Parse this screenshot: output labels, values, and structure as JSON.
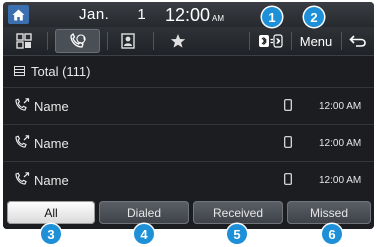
{
  "status_bar": {
    "date_month": "Jan.",
    "date_day": "1",
    "time": "12:00",
    "ampm": "AM"
  },
  "tabs": {
    "icons": [
      "dialpad-icon",
      "call-history-icon",
      "contacts-icon",
      "favorites-icon",
      "bluetooth-device-icon"
    ],
    "active": "call-history-icon",
    "menu_label": "Menu",
    "back_icon": "back-icon"
  },
  "list": {
    "header": "Total (111)",
    "rows": [
      {
        "name": "Name",
        "time": "12:00 AM"
      },
      {
        "name": "Name",
        "time": "12:00 AM"
      },
      {
        "name": "Name",
        "time": "12:00 AM"
      }
    ]
  },
  "filters": {
    "all": "All",
    "dialed": "Dialed",
    "received": "Received",
    "missed": "Missed"
  },
  "callouts": [
    "1",
    "2",
    "3",
    "4",
    "5",
    "6"
  ],
  "colors": {
    "accent": "#1e90d8",
    "home_button": "#3b6fb0",
    "background": "#1b1d20"
  }
}
